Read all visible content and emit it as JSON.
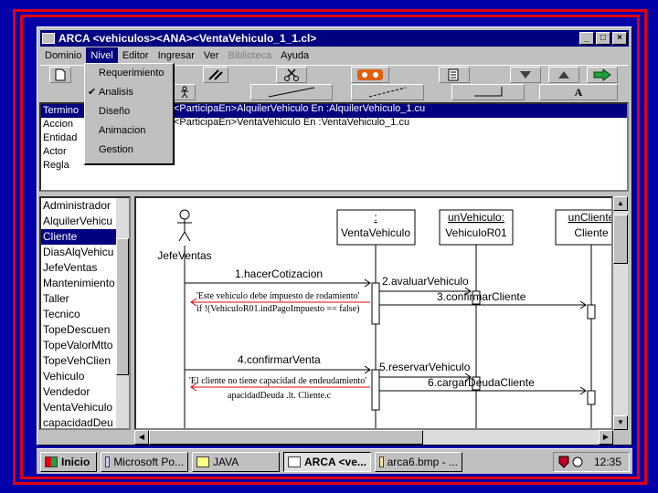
{
  "window": {
    "title": "ARCA <vehiculos><ANA><VentaVehiculo_1_1.cl>",
    "minimize_glyph": "_",
    "maximize_glyph": "□",
    "close_glyph": "×"
  },
  "menubar": [
    "Dominio",
    "Nivel",
    "Editor",
    "Ingresar",
    "Ver",
    "Biblioteca",
    "Ayuda"
  ],
  "nivel_menu": {
    "items": [
      "Requerimiento",
      "Analisis",
      "Diseño",
      "Animacion",
      "Gestion"
    ],
    "checked": "Analisis",
    "check_glyph": "✔"
  },
  "toolbar": {
    "text_tool": "A"
  },
  "type_list": [
    "Termino",
    "Accion",
    "Entidad",
    "Actor",
    "Regla"
  ],
  "relations": [
    "<ParticipaEn>AlquilerVehiculo En :AlquilerVehiculo_1.cu",
    "<ParticipaEn>VentaVehiculo En :VentaVehiculo_1.cu"
  ],
  "element_list": [
    "Administrador",
    "AlquilerVehicu",
    "Cliente",
    "DiasAlqVehicu",
    "JefeVentas",
    "Mantenimiento",
    "Taller",
    "Tecnico",
    "TopeDescuen",
    "TopeValorMtto",
    "TopeVehClien",
    "Vehiculo",
    "Vendedor",
    "VentaVehiculo",
    "capacidadDeu"
  ],
  "selected_element": "Cliente",
  "diagram": {
    "actor": "JefeVentas",
    "objects": [
      {
        "line1": ":",
        "line2": "VentaVehiculo"
      },
      {
        "line1": "unVehiculo:",
        "line2": "VehiculoR01"
      },
      {
        "line1": "unCliente",
        "line2": "Cliente"
      }
    ],
    "messages": [
      "1.hacerCotizacion",
      "2.avaluarVehiculo",
      "3.confirmarCliente",
      "4.confirmarVenta",
      "5.reservarVehiculo",
      "6.cargarDeudaCliente"
    ],
    "notes": [
      "'Este vehiculo debe impuesto de rodamiento'",
      "if !(VehiculoR01.indPagoImpuesto == false)",
      "'El cliente no tiene capacidad de endeudamiento'",
      "apacidadDeuda .lt. Cliente.c"
    ]
  },
  "taskbar": {
    "start": "Inicio",
    "tasks": [
      "Microsoft Po...",
      "JAVA",
      "ARCA <ve...",
      "arca6.bmp - ..."
    ],
    "active_task": "ARCA <ve...",
    "clock": "12:35"
  },
  "colors": {
    "title": "#000080",
    "frame": "#e00010",
    "background": "#0000a8",
    "note_line": "#e00010"
  }
}
